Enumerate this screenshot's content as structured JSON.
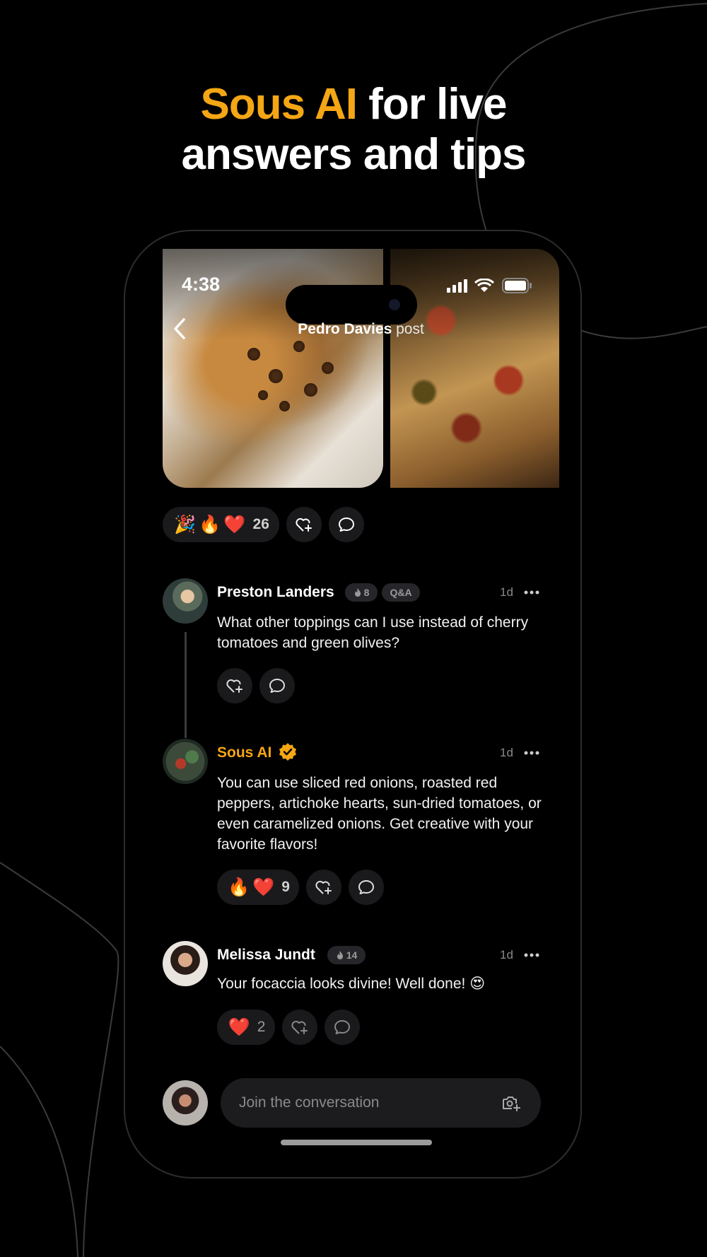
{
  "headline": {
    "accent": "Sous AI",
    "rest1": " for live",
    "line2": "answers and tips"
  },
  "status_bar": {
    "time": "4:38"
  },
  "nav": {
    "author": "Pedro Davies",
    "suffix": " post"
  },
  "post_reactions": {
    "emojis": [
      "🎉",
      "🔥",
      "❤️"
    ],
    "count": "26"
  },
  "comments": [
    {
      "name": "Preston Landers",
      "flame_count": "8",
      "tag": "Q&A",
      "time": "1d",
      "text": "What other toppings can I use instead of cherry tomatoes and green olives?"
    },
    {
      "name": "Sous AI",
      "verified": true,
      "time": "1d",
      "text": "You can use sliced red onions, roasted red peppers, artichoke hearts, sun-dried tomatoes, or even caramelized onions. Get creative with your favorite flavors!",
      "reactions": {
        "emojis": [
          "🔥",
          "❤️"
        ],
        "count": "9"
      }
    },
    {
      "name": "Melissa Jundt",
      "flame_count": "14",
      "time": "1d",
      "text": "Your focaccia looks divine! Well done! 😍",
      "reactions": {
        "emojis": [
          "❤️"
        ],
        "count": "2"
      }
    }
  ],
  "composer": {
    "placeholder": "Join the conversation"
  },
  "colors": {
    "accent": "#f5a614",
    "background": "#000000",
    "chip": "#1a1a1c"
  },
  "icons": [
    "back-chevron-icon",
    "signal-icon",
    "wifi-icon",
    "battery-icon",
    "heart-plus-icon",
    "comment-icon",
    "more-icon",
    "flame-icon",
    "verified-badge-icon",
    "camera-plus-icon"
  ]
}
